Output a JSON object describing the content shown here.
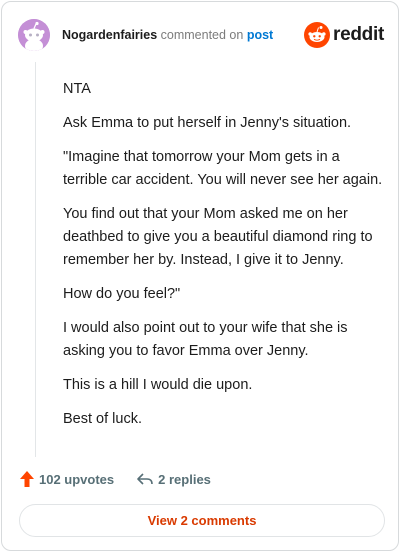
{
  "header": {
    "username": "Nogardenfairies",
    "action_text": "commented on",
    "link_text": "post",
    "brand_wordmark": "reddit"
  },
  "comment": {
    "paragraphs": [
      "NTA",
      "Ask Emma to put herself in Jenny's situation.",
      "\"Imagine that tomorrow your Mom gets in a terrible car accident. You will never see her again.",
      "You find out that your Mom asked me on her deathbed to give you a beautiful diamond ring to remember her by. Instead, I give it to Jenny.",
      "How do you feel?\"",
      "I would also point out to your wife that she is asking you to favor Emma over Jenny.",
      "This is a hill I would die upon.",
      "Best of luck."
    ]
  },
  "actions": {
    "upvotes": "102 upvotes",
    "replies": "2 replies"
  },
  "footer": {
    "view_comments_label": "View 2 comments"
  },
  "icons": {
    "avatar": "snoo-avatar-icon",
    "brand": "reddit-logo-icon",
    "upvote": "upvote-arrow-icon",
    "reply": "reply-arrow-icon"
  },
  "colors": {
    "avatar_bg": "#c48fd6",
    "upvote": "#ff4500",
    "link": "#0079d3",
    "view_button_text": "#d93a00"
  }
}
